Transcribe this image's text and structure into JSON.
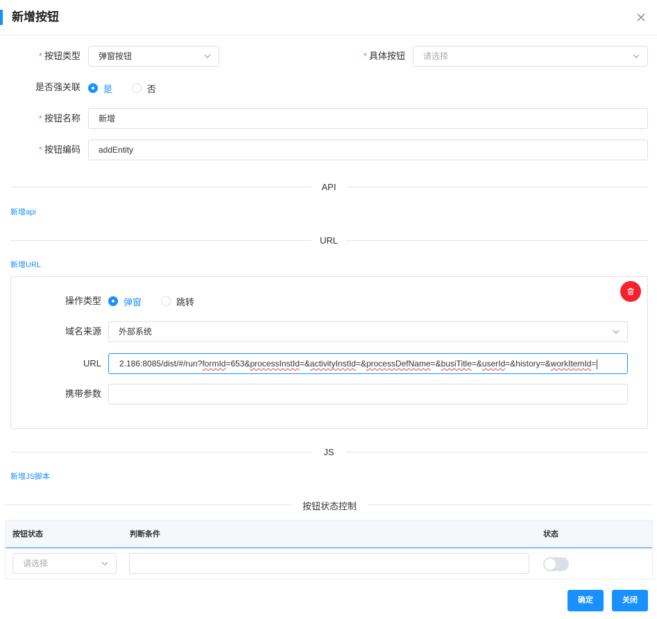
{
  "dialog": {
    "title": "新增按钮"
  },
  "form": {
    "button_type": {
      "label": "按钮类型",
      "value": "弹窗按钮"
    },
    "specific_button": {
      "label": "具体按钮",
      "placeholder": "请选择"
    },
    "force_relate": {
      "label": "是否强关联",
      "options": [
        "是",
        "否"
      ],
      "selected": "是"
    },
    "button_name": {
      "label": "按钮名称",
      "value": "新增"
    },
    "button_code": {
      "label": "按钮编码",
      "value": "addEntity"
    }
  },
  "sections": {
    "api": {
      "title": "API",
      "add_link": "新增api"
    },
    "url": {
      "title": "URL",
      "add_link": "新增URL"
    },
    "js": {
      "title": "JS",
      "add_link": "新增JS脚本"
    },
    "state": {
      "title": "按钮状态控制"
    }
  },
  "url_item": {
    "op_type": {
      "label": "操作类型",
      "options": [
        "弹窗",
        "跳转"
      ],
      "selected": "弹窗"
    },
    "domain_source": {
      "label": "域名来源",
      "value": "外部系统"
    },
    "url": {
      "label": "URL",
      "segments": [
        {
          "text": "2.186:8085/dist/#/run?",
          "underline": false
        },
        {
          "text": "formId",
          "underline": true
        },
        {
          "text": "=653&",
          "underline": false
        },
        {
          "text": "processInstId",
          "underline": true
        },
        {
          "text": "=&",
          "underline": false
        },
        {
          "text": "activityInstId",
          "underline": true
        },
        {
          "text": "=&",
          "underline": false
        },
        {
          "text": "processDefName",
          "underline": true
        },
        {
          "text": "=&",
          "underline": false
        },
        {
          "text": "busiTitle",
          "underline": true
        },
        {
          "text": "=&",
          "underline": false
        },
        {
          "text": "userId",
          "underline": true
        },
        {
          "text": "=&history=&",
          "underline": false
        },
        {
          "text": "workItemId",
          "underline": true
        },
        {
          "text": "=",
          "underline": false
        }
      ]
    },
    "params": {
      "label": "携带参数",
      "value": ""
    }
  },
  "state_table": {
    "columns": [
      "按钮状态",
      "判断条件",
      "状态"
    ],
    "row": {
      "state_placeholder": "请选择",
      "condition": "",
      "enabled": false
    }
  },
  "footer": {
    "confirm": "确定",
    "close": "关闭"
  },
  "colors": {
    "primary": "#1890ff",
    "danger": "#f5222d",
    "required": "#f56c6c"
  }
}
